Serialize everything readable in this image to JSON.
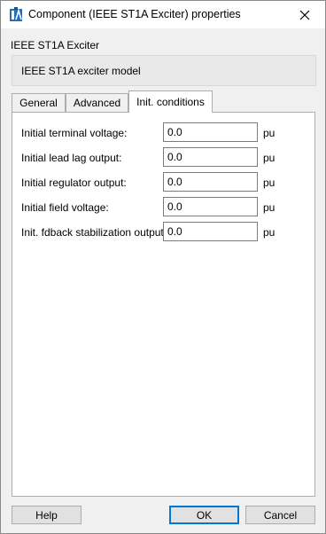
{
  "window": {
    "title": "Component (IEEE ST1A Exciter) properties"
  },
  "component": {
    "type_label": "IEEE ST1A Exciter",
    "description": "IEEE ST1A exciter model"
  },
  "tabs": [
    {
      "label": "General",
      "active": false
    },
    {
      "label": "Advanced",
      "active": false
    },
    {
      "label": "Init. conditions",
      "active": true
    }
  ],
  "fields": [
    {
      "label": "Initial terminal voltage:",
      "value": "0.0",
      "unit": "pu"
    },
    {
      "label": "Initial lead lag output:",
      "value": "0.0",
      "unit": "pu"
    },
    {
      "label": "Initial regulator output:",
      "value": "0.0",
      "unit": "pu"
    },
    {
      "label": "Initial field voltage:",
      "value": "0.0",
      "unit": "pu"
    },
    {
      "label": "Init. fdback stabilization output:",
      "value": "0.0",
      "unit": "pu"
    }
  ],
  "buttons": {
    "help": "Help",
    "ok": "OK",
    "cancel": "Cancel"
  }
}
